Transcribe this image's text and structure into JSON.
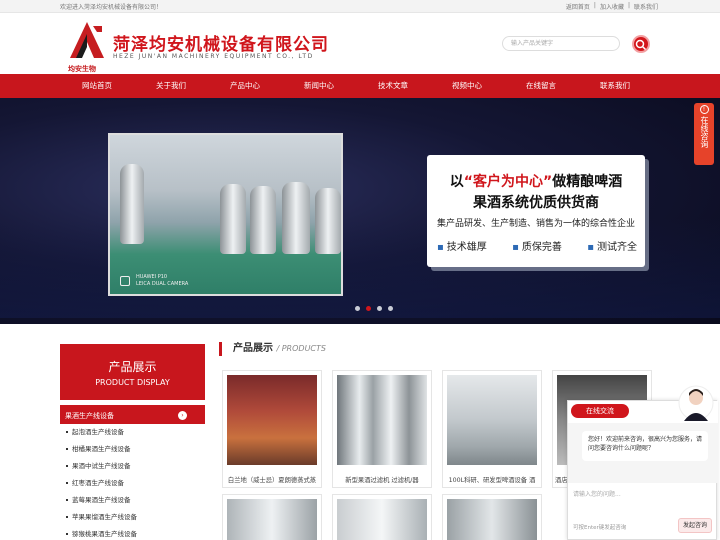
{
  "topbar": {
    "welcome": "欢迎进入菏泽均安机械设备有限公司！",
    "links": [
      "返回首页",
      "|",
      "加入收藏",
      "|",
      "联系我们"
    ]
  },
  "header": {
    "logo_text": "均安生物",
    "company_name": "菏泽均安机械设备有限公司",
    "company_en": "HEZE JUN'AN MACHINERY EQUIPMENT CO., LTD",
    "search_placeholder": "输入产品关键字"
  },
  "nav": [
    "网站首页",
    "关于我们",
    "产品中心",
    "新闻中心",
    "技术文章",
    "视频中心",
    "在线留言",
    "联系我们"
  ],
  "banner": {
    "headline_prefix": "以",
    "headline_quote": "“客户为中心”",
    "headline_suffix": "做精酿啤酒",
    "headline2": "果酒系统优质供货商",
    "subline": "集产品研发、生产制造、销售为一体的综合性企业",
    "points": [
      "技术雄厚",
      "质保完善",
      "测试齐全"
    ],
    "photo_caption_1": "HUAWEI P10",
    "photo_caption_2": "LEICA DUAL CAMERA",
    "active_dot": 1
  },
  "float_consult": "在线咨询",
  "sidebar": {
    "title_zh": "产品展示",
    "title_en": "PRODUCT DISPLAY",
    "category": "果酒生产线设备",
    "items": [
      "起泡酒生产线设备",
      "柑橘果酒生产线设备",
      "果酒中试生产线设备",
      "红枣酒生产线设备",
      "蓝莓果酒生产线设备",
      "苹果果馏酒生产线设备",
      "猕猴桃果酒生产线设备"
    ]
  },
  "products": {
    "title_zh": "产品展示",
    "title_en": "/ PRODUCTS",
    "items": [
      {
        "caption": "白兰地（威士忌）夏朗德蒸式蒸"
      },
      {
        "caption": "新型果酒过滤机 过滤机/器"
      },
      {
        "caption": "100L科研、研发型啤酒设备 酒"
      },
      {
        "caption": "酒店"
      }
    ]
  },
  "chat": {
    "tab": "在线交流",
    "message": "您好！欢迎前来咨询，很高兴为您服务，请问您要咨询什么问题呢？",
    "input_placeholder": "请输入您的问题...",
    "hint": "可按Enter键发起咨询",
    "send": "发起咨询"
  }
}
